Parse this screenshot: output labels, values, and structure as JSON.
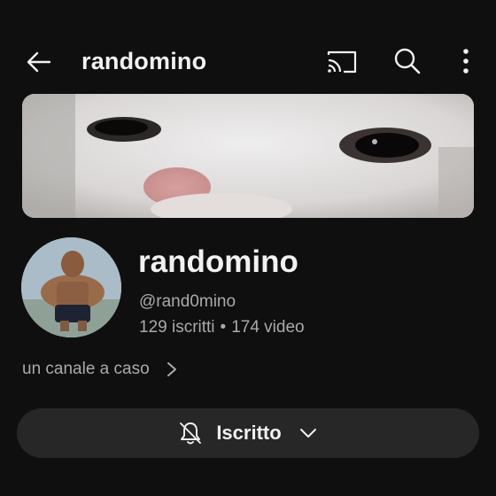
{
  "appbar": {
    "title": "randomino",
    "icons": [
      "back-arrow-icon",
      "cast-icon",
      "search-icon",
      "more-vert-icon"
    ]
  },
  "banner": {
    "description": "close-up photo of a white cat's face"
  },
  "channel": {
    "name": "randomino",
    "handle": "@rand0mino",
    "subscribers": "129 iscritti",
    "separator": "•",
    "videos": "174 video",
    "description": "un canale a caso"
  },
  "subscribe_button": {
    "label": "Iscritto",
    "icons": [
      "bell-off-icon",
      "chevron-down-icon"
    ]
  },
  "colors": {
    "background": "#0f0f0f",
    "text_primary": "#f1f1f1",
    "text_secondary": "#aaaaaa",
    "button_bg": "#272727"
  }
}
